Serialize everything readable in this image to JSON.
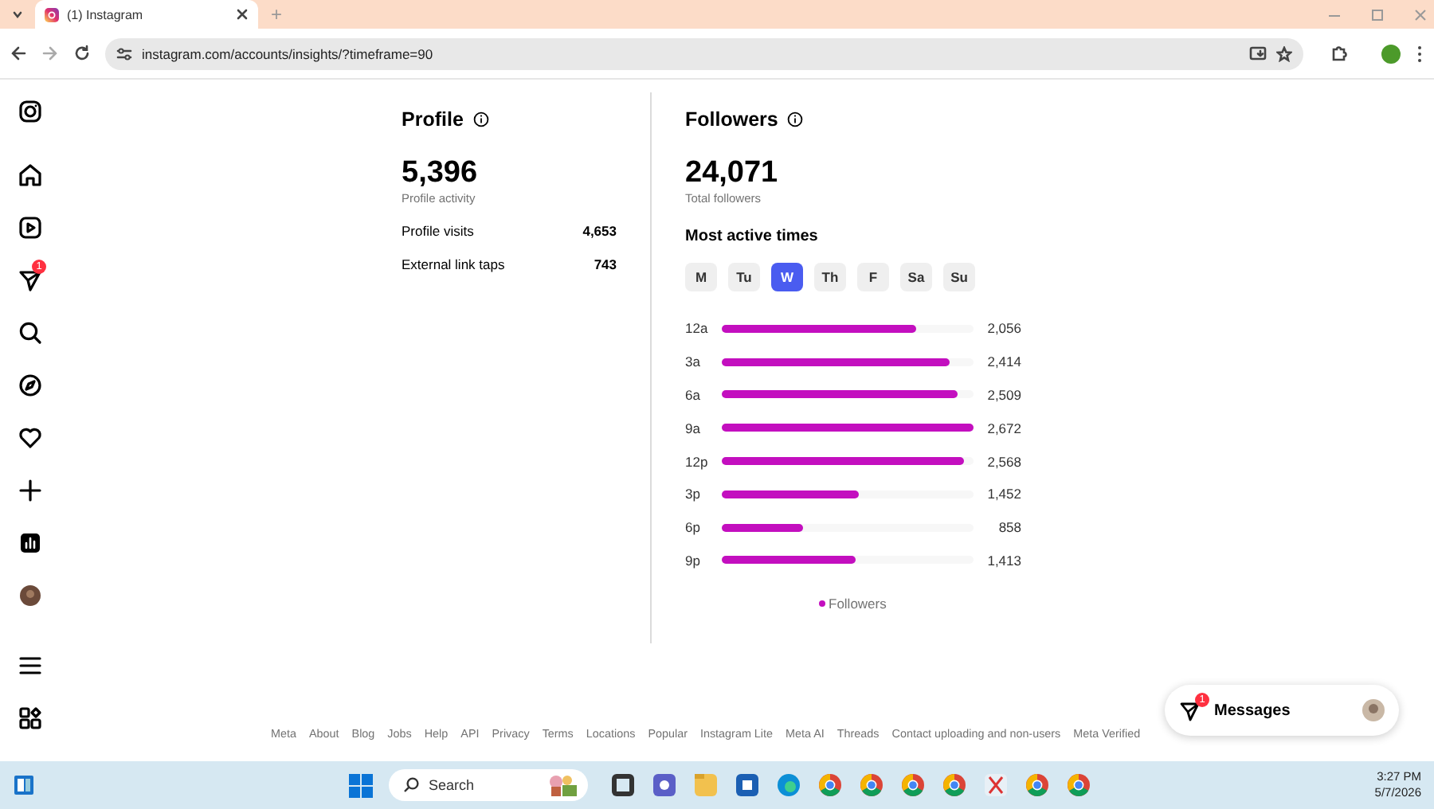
{
  "browser": {
    "tab_title": "(1) Instagram",
    "new_tab": "+",
    "address": "instagram.com/accounts/insights/?timeframe=90"
  },
  "sidebar": {
    "notification_badge": "1"
  },
  "profile": {
    "title": "Profile",
    "total": "5,396",
    "total_label": "Profile activity",
    "metrics": [
      {
        "label": "Profile visits",
        "value": "4,653"
      },
      {
        "label": "External link taps",
        "value": "743"
      }
    ]
  },
  "followers": {
    "title": "Followers",
    "total": "24,071",
    "total_label": "Total followers",
    "section_title": "Most active times",
    "days": [
      {
        "label": "M",
        "selected": false
      },
      {
        "label": "Tu",
        "selected": false
      },
      {
        "label": "W",
        "selected": true
      },
      {
        "label": "Th",
        "selected": false
      },
      {
        "label": "F",
        "selected": false
      },
      {
        "label": "Sa",
        "selected": false
      },
      {
        "label": "Su",
        "selected": false
      }
    ],
    "active_times": [
      {
        "time": "12a",
        "level": 0.769,
        "count": "2,056"
      },
      {
        "time": "3a",
        "level": 0.903,
        "count": "2,414"
      },
      {
        "time": "6a",
        "level": 0.939,
        "count": "2,509"
      },
      {
        "time": "9a",
        "level": 1.0,
        "count": "2,672"
      },
      {
        "time": "12p",
        "level": 0.961,
        "count": "2,568"
      },
      {
        "time": "3p",
        "level": 0.543,
        "count": "1,452"
      },
      {
        "time": "6p",
        "level": 0.321,
        "count": "858"
      },
      {
        "time": "9p",
        "level": 0.529,
        "count": "1,413"
      }
    ],
    "legend": "Followers"
  },
  "footer": {
    "links": [
      "Meta",
      "About",
      "Blog",
      "Jobs",
      "Help",
      "API",
      "Privacy",
      "Terms",
      "Locations",
      "Popular",
      "Instagram Lite",
      "Meta AI",
      "Threads",
      "Contact uploading and non-users",
      "Meta Verified"
    ]
  },
  "messages": {
    "label": "Messages",
    "badge": "1"
  },
  "taskbar": {
    "search_placeholder": "Search",
    "time": "3:27 PM",
    "date": "5/7/2026"
  }
}
